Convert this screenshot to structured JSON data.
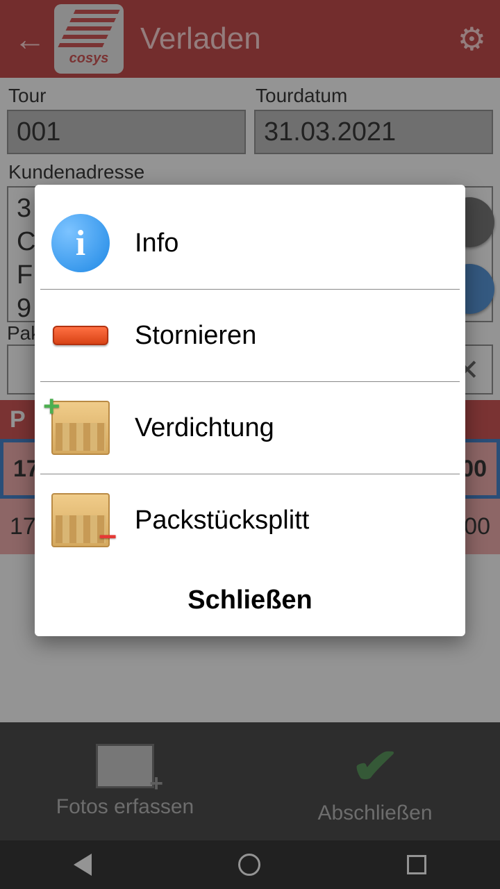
{
  "header": {
    "title": "Verladen"
  },
  "fields": {
    "tour": {
      "label": "Tour",
      "value": "001"
    },
    "tourdatum": {
      "label": "Tourdatum",
      "value": "31.03.2021"
    },
    "kundenadresse": {
      "label": "Kundenadresse",
      "lines": [
        "3",
        "C",
        "F",
        "9"
      ]
    },
    "packstueck": {
      "label": "Pak"
    }
  },
  "table": {
    "header": {
      "col1": "P",
      "col2_prefix": ""
    },
    "rows": [
      {
        "c1": "17",
        "c2": "000",
        "selected": true
      },
      {
        "c1": "17",
        "c2": "000",
        "selected": false
      }
    ]
  },
  "bottombar": {
    "foto": "Fotos erfassen",
    "abschliessen": "Abschließen"
  },
  "dialog": {
    "items": [
      {
        "key": "info",
        "label": "Info"
      },
      {
        "key": "stornieren",
        "label": "Stornieren"
      },
      {
        "key": "verdichtung",
        "label": "Verdichtung"
      },
      {
        "key": "packsplit",
        "label": "Packstücksplitt"
      }
    ],
    "close": "Schließen"
  },
  "logo_text": "cosys"
}
